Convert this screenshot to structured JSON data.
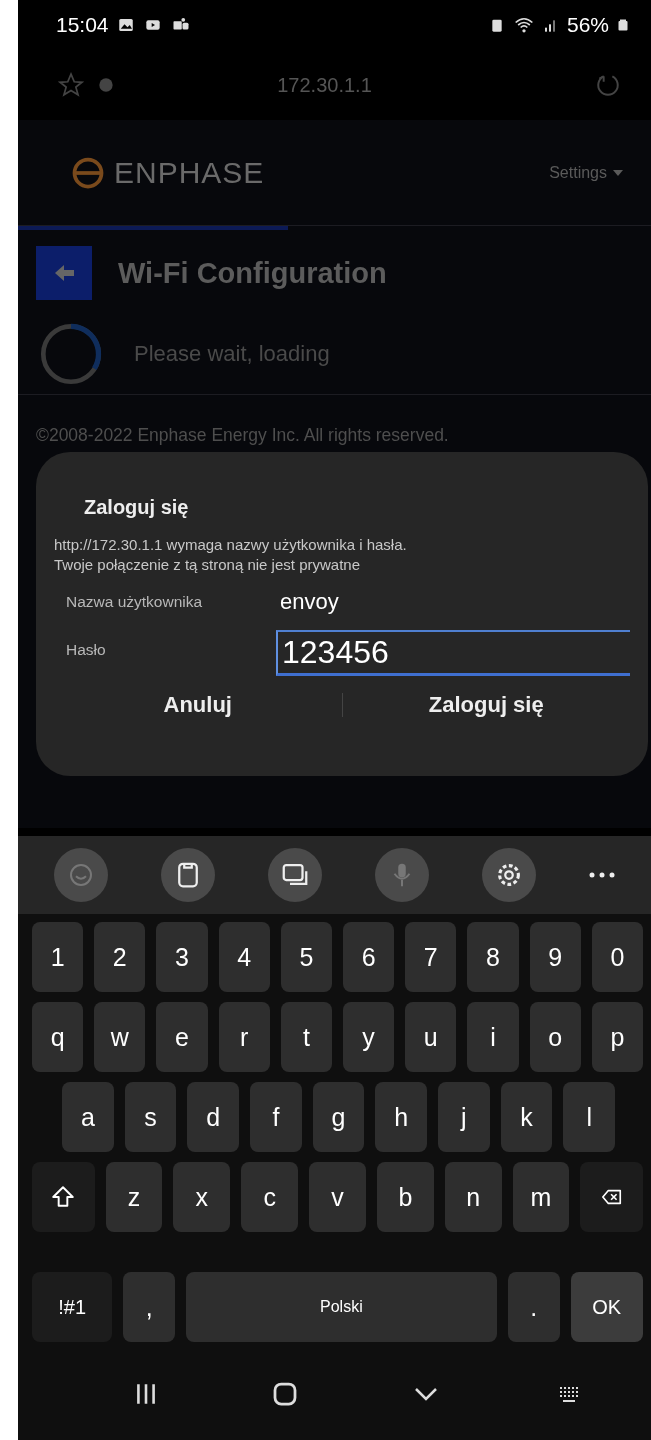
{
  "status_bar": {
    "time": "15:04",
    "battery": "56%"
  },
  "address_bar": {
    "url": "172.30.1.1"
  },
  "header": {
    "logo": "ENPHASE",
    "menu": "Settings"
  },
  "page": {
    "title": "Wi-Fi Configuration",
    "loading": "Please wait, loading",
    "footer": "©2008-2022 Enphase Energy Inc. All rights reserved."
  },
  "dialog": {
    "title": "Zaloguj się",
    "message": "http://172.30.1.1 wymaga nazwy użytkownika i hasła.\nTwoje połączenie z tą stroną nie jest prywatne",
    "fields": [
      {
        "label": "Nazwa użytkownika",
        "value": "envoy",
        "focused": false
      },
      {
        "label": "Hasło",
        "value": "123456",
        "focused": true
      }
    ],
    "buttons": [
      "Anuluj",
      "Zaloguj się"
    ]
  },
  "keyboard": {
    "rows": [
      {
        "keys": [
          {
            "kind": "char",
            "label": "1"
          },
          {
            "kind": "char",
            "label": "2"
          },
          {
            "kind": "char",
            "label": "3"
          },
          {
            "kind": "char",
            "label": "4"
          },
          {
            "kind": "char",
            "label": "5"
          },
          {
            "kind": "char",
            "label": "6"
          },
          {
            "kind": "char",
            "label": "7"
          },
          {
            "kind": "char",
            "label": "8"
          },
          {
            "kind": "char",
            "label": "9"
          },
          {
            "kind": "char",
            "label": "0"
          }
        ]
      },
      {
        "keys": [
          {
            "kind": "char",
            "label": "q"
          },
          {
            "kind": "char",
            "label": "w"
          },
          {
            "kind": "char",
            "label": "e"
          },
          {
            "kind": "char",
            "label": "r"
          },
          {
            "kind": "char",
            "label": "t"
          },
          {
            "kind": "char",
            "label": "y"
          },
          {
            "kind": "char",
            "label": "u"
          },
          {
            "kind": "char",
            "label": "i"
          },
          {
            "kind": "char",
            "label": "o"
          },
          {
            "kind": "char",
            "label": "p"
          }
        ]
      },
      {
        "keys": [
          {
            "kind": "char",
            "label": "a"
          },
          {
            "kind": "char",
            "label": "s"
          },
          {
            "kind": "char",
            "label": "d"
          },
          {
            "kind": "char",
            "label": "f"
          },
          {
            "kind": "char",
            "label": "g"
          },
          {
            "kind": "char",
            "label": "h"
          },
          {
            "kind": "char",
            "label": "j"
          },
          {
            "kind": "char",
            "label": "k"
          },
          {
            "kind": "char",
            "label": "l"
          }
        ]
      },
      {
        "keys": [
          {
            "kind": "shift"
          },
          {
            "kind": "char",
            "label": "z"
          },
          {
            "kind": "char",
            "label": "x"
          },
          {
            "kind": "char",
            "label": "c"
          },
          {
            "kind": "char",
            "label": "v"
          },
          {
            "kind": "char",
            "label": "b"
          },
          {
            "kind": "char",
            "label": "n"
          },
          {
            "kind": "char",
            "label": "m"
          },
          {
            "kind": "backspace"
          }
        ]
      },
      {
        "keys": [
          {
            "kind": "symbols",
            "label": "!#1"
          },
          {
            "kind": "char",
            "label": ","
          },
          {
            "kind": "space",
            "label": "Polski"
          },
          {
            "kind": "char",
            "label": "."
          },
          {
            "kind": "action",
            "label": "OK"
          }
        ]
      }
    ]
  }
}
